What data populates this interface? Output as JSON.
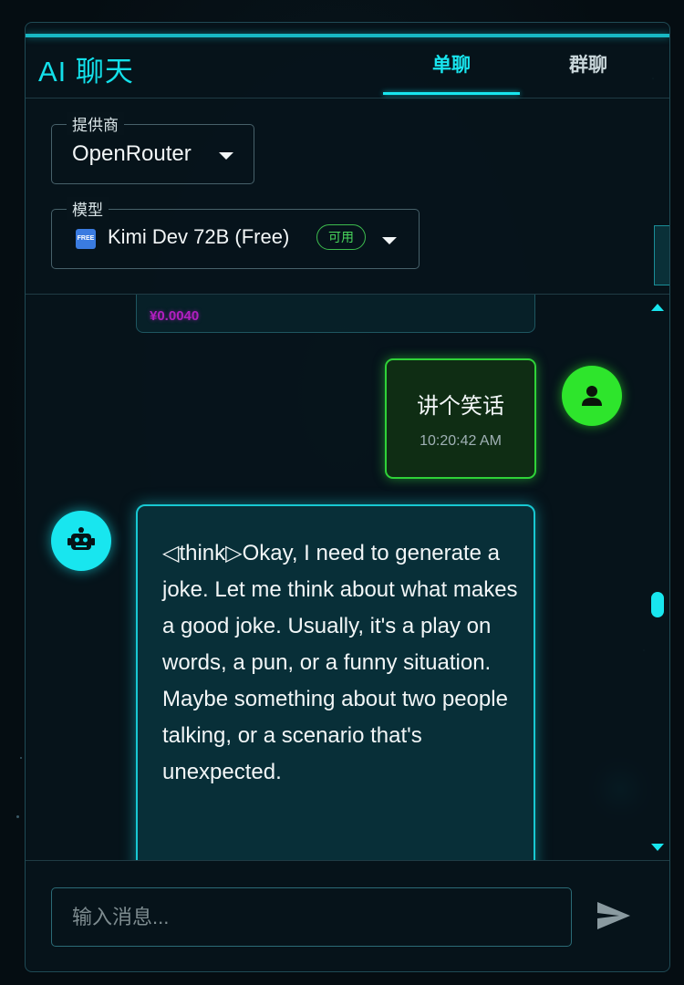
{
  "header": {
    "title": "AI 聊天",
    "tabs": [
      {
        "label": "单聊",
        "active": true
      },
      {
        "label": "群聊",
        "active": false
      }
    ]
  },
  "settings": {
    "provider": {
      "label": "提供商",
      "value": "OpenRouter"
    },
    "model": {
      "label": "模型",
      "badge_icon": "FREE",
      "value": "Kimi Dev 72B (Free)",
      "status": "可用"
    }
  },
  "messages": [
    {
      "role": "assistant",
      "partial": true,
      "cost": "¥0.0040"
    },
    {
      "role": "user",
      "text": "讲个笑话",
      "time": "10:20:42 AM"
    },
    {
      "role": "assistant",
      "text": "◁think▷Okay, I need to generate a joke. Let me think about what makes a good joke. Usually, it's a play on words, a pun, or a funny situation. Maybe something about two people talking, or a scenario that's unexpected."
    }
  ],
  "composer": {
    "placeholder": "输入消息..."
  },
  "icons": {
    "user_avatar": "user-icon",
    "bot_avatar": "robot-icon",
    "send": "send-icon",
    "scroll_up": "arrow-up-icon",
    "scroll_down": "arrow-down-icon"
  },
  "colors": {
    "accent": "#18e6ef",
    "user_accent": "#2ee52c",
    "cost": "#b11fc0",
    "available": "#49d85c"
  }
}
